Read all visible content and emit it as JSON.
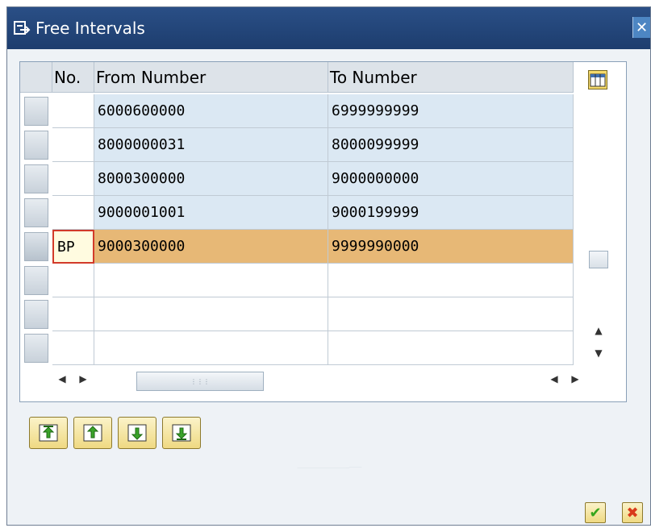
{
  "window": {
    "title": "Free Intervals",
    "close_label": "✕"
  },
  "table": {
    "headers": [
      "No.",
      "From Number",
      "To Number"
    ],
    "rows": [
      {
        "no": "",
        "from": "6000600000",
        "to": "6999999999"
      },
      {
        "no": "",
        "from": "8000000031",
        "to": "8000099999"
      },
      {
        "no": "",
        "from": "8000300000",
        "to": "9000000000"
      },
      {
        "no": "",
        "from": "9000001001",
        "to": "9000199999"
      },
      {
        "no": "BP",
        "from": "9000300000",
        "to": "9999990000"
      },
      {
        "no": "",
        "from": "",
        "to": ""
      },
      {
        "no": "",
        "from": "",
        "to": ""
      },
      {
        "no": "",
        "from": "",
        "to": ""
      }
    ],
    "selected_row_index": 4
  },
  "icons": {
    "title": "dialog-icon",
    "column_settings": "column-settings-icon",
    "page_top": "first-page-icon",
    "page_up": "previous-page-icon",
    "page_down": "next-page-icon",
    "page_bottom": "last-page-icon",
    "confirm": "checkmark-icon",
    "cancel": "cancel-icon"
  },
  "colors": {
    "titlebar": "#1d3d6e",
    "row_fill": "#dbe8f3",
    "selected_row": "#e7b876",
    "focus_border": "#d23a2a",
    "confirm": "#36a51c",
    "cancel": "#d83a1a"
  }
}
